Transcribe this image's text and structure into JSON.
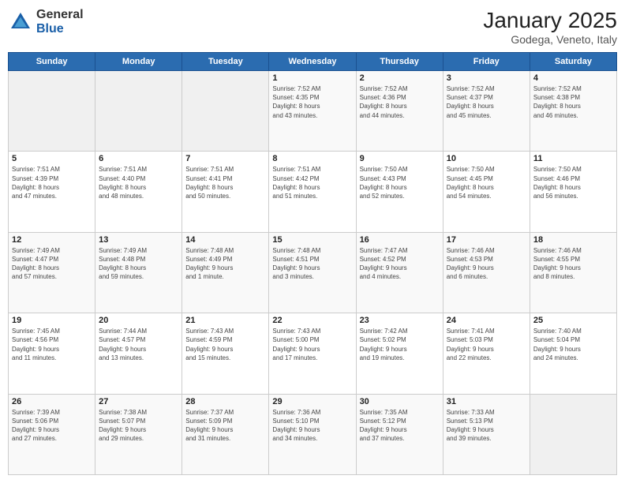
{
  "logo": {
    "general": "General",
    "blue": "Blue"
  },
  "header": {
    "title": "January 2025",
    "location": "Godega, Veneto, Italy"
  },
  "weekdays": [
    "Sunday",
    "Monday",
    "Tuesday",
    "Wednesday",
    "Thursday",
    "Friday",
    "Saturday"
  ],
  "weeks": [
    [
      {
        "day": "",
        "info": ""
      },
      {
        "day": "",
        "info": ""
      },
      {
        "day": "",
        "info": ""
      },
      {
        "day": "1",
        "info": "Sunrise: 7:52 AM\nSunset: 4:35 PM\nDaylight: 8 hours\nand 43 minutes."
      },
      {
        "day": "2",
        "info": "Sunrise: 7:52 AM\nSunset: 4:36 PM\nDaylight: 8 hours\nand 44 minutes."
      },
      {
        "day": "3",
        "info": "Sunrise: 7:52 AM\nSunset: 4:37 PM\nDaylight: 8 hours\nand 45 minutes."
      },
      {
        "day": "4",
        "info": "Sunrise: 7:52 AM\nSunset: 4:38 PM\nDaylight: 8 hours\nand 46 minutes."
      }
    ],
    [
      {
        "day": "5",
        "info": "Sunrise: 7:51 AM\nSunset: 4:39 PM\nDaylight: 8 hours\nand 47 minutes."
      },
      {
        "day": "6",
        "info": "Sunrise: 7:51 AM\nSunset: 4:40 PM\nDaylight: 8 hours\nand 48 minutes."
      },
      {
        "day": "7",
        "info": "Sunrise: 7:51 AM\nSunset: 4:41 PM\nDaylight: 8 hours\nand 50 minutes."
      },
      {
        "day": "8",
        "info": "Sunrise: 7:51 AM\nSunset: 4:42 PM\nDaylight: 8 hours\nand 51 minutes."
      },
      {
        "day": "9",
        "info": "Sunrise: 7:50 AM\nSunset: 4:43 PM\nDaylight: 8 hours\nand 52 minutes."
      },
      {
        "day": "10",
        "info": "Sunrise: 7:50 AM\nSunset: 4:45 PM\nDaylight: 8 hours\nand 54 minutes."
      },
      {
        "day": "11",
        "info": "Sunrise: 7:50 AM\nSunset: 4:46 PM\nDaylight: 8 hours\nand 56 minutes."
      }
    ],
    [
      {
        "day": "12",
        "info": "Sunrise: 7:49 AM\nSunset: 4:47 PM\nDaylight: 8 hours\nand 57 minutes."
      },
      {
        "day": "13",
        "info": "Sunrise: 7:49 AM\nSunset: 4:48 PM\nDaylight: 8 hours\nand 59 minutes."
      },
      {
        "day": "14",
        "info": "Sunrise: 7:48 AM\nSunset: 4:49 PM\nDaylight: 9 hours\nand 1 minute."
      },
      {
        "day": "15",
        "info": "Sunrise: 7:48 AM\nSunset: 4:51 PM\nDaylight: 9 hours\nand 3 minutes."
      },
      {
        "day": "16",
        "info": "Sunrise: 7:47 AM\nSunset: 4:52 PM\nDaylight: 9 hours\nand 4 minutes."
      },
      {
        "day": "17",
        "info": "Sunrise: 7:46 AM\nSunset: 4:53 PM\nDaylight: 9 hours\nand 6 minutes."
      },
      {
        "day": "18",
        "info": "Sunrise: 7:46 AM\nSunset: 4:55 PM\nDaylight: 9 hours\nand 8 minutes."
      }
    ],
    [
      {
        "day": "19",
        "info": "Sunrise: 7:45 AM\nSunset: 4:56 PM\nDaylight: 9 hours\nand 11 minutes."
      },
      {
        "day": "20",
        "info": "Sunrise: 7:44 AM\nSunset: 4:57 PM\nDaylight: 9 hours\nand 13 minutes."
      },
      {
        "day": "21",
        "info": "Sunrise: 7:43 AM\nSunset: 4:59 PM\nDaylight: 9 hours\nand 15 minutes."
      },
      {
        "day": "22",
        "info": "Sunrise: 7:43 AM\nSunset: 5:00 PM\nDaylight: 9 hours\nand 17 minutes."
      },
      {
        "day": "23",
        "info": "Sunrise: 7:42 AM\nSunset: 5:02 PM\nDaylight: 9 hours\nand 19 minutes."
      },
      {
        "day": "24",
        "info": "Sunrise: 7:41 AM\nSunset: 5:03 PM\nDaylight: 9 hours\nand 22 minutes."
      },
      {
        "day": "25",
        "info": "Sunrise: 7:40 AM\nSunset: 5:04 PM\nDaylight: 9 hours\nand 24 minutes."
      }
    ],
    [
      {
        "day": "26",
        "info": "Sunrise: 7:39 AM\nSunset: 5:06 PM\nDaylight: 9 hours\nand 27 minutes."
      },
      {
        "day": "27",
        "info": "Sunrise: 7:38 AM\nSunset: 5:07 PM\nDaylight: 9 hours\nand 29 minutes."
      },
      {
        "day": "28",
        "info": "Sunrise: 7:37 AM\nSunset: 5:09 PM\nDaylight: 9 hours\nand 31 minutes."
      },
      {
        "day": "29",
        "info": "Sunrise: 7:36 AM\nSunset: 5:10 PM\nDaylight: 9 hours\nand 34 minutes."
      },
      {
        "day": "30",
        "info": "Sunrise: 7:35 AM\nSunset: 5:12 PM\nDaylight: 9 hours\nand 37 minutes."
      },
      {
        "day": "31",
        "info": "Sunrise: 7:33 AM\nSunset: 5:13 PM\nDaylight: 9 hours\nand 39 minutes."
      },
      {
        "day": "",
        "info": ""
      }
    ]
  ]
}
